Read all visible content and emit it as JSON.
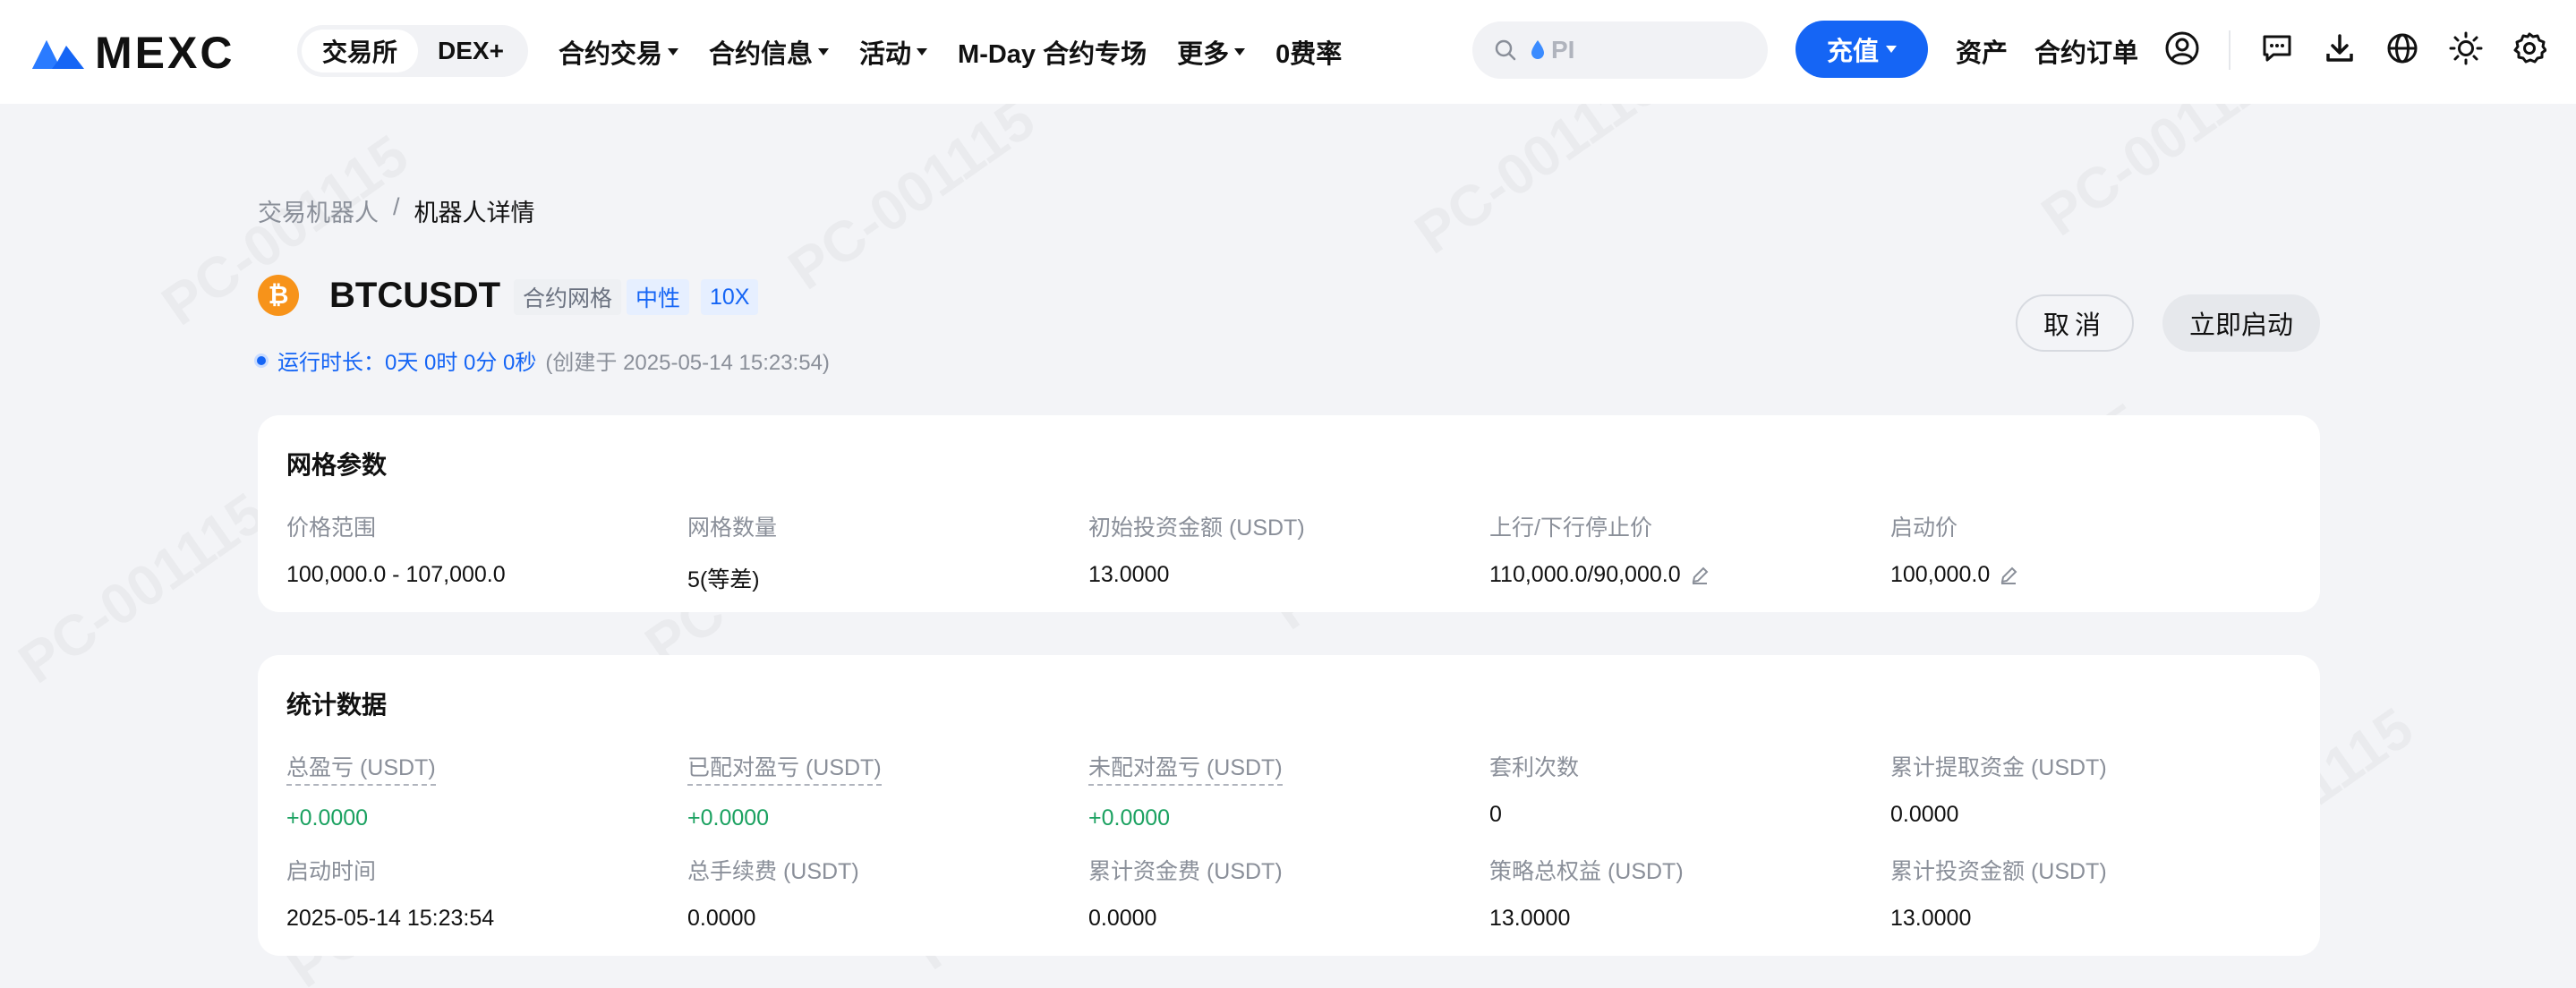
{
  "header": {
    "logo_text": "MEXC",
    "segment": {
      "active": "交易所",
      "other": "DEX+"
    },
    "nav": [
      {
        "label": "合约交易",
        "dropdown": true
      },
      {
        "label": "合约信息",
        "dropdown": true
      },
      {
        "label": "活动",
        "dropdown": true
      },
      {
        "label": "M-Day 合约专场",
        "dropdown": false
      },
      {
        "label": "更多",
        "dropdown": true
      },
      {
        "label": "0费率",
        "dropdown": false
      }
    ],
    "search_placeholder": "PI",
    "deposit_label": "充值",
    "assets_label": "资产",
    "orders_label": "合约订单",
    "icons": [
      "user-icon",
      "message-icon",
      "download-icon",
      "globe-icon",
      "theme-sun-icon",
      "settings-gear-icon"
    ]
  },
  "breadcrumb": {
    "parent": "交易机器人",
    "separator": "/",
    "current": "机器人详情"
  },
  "bot": {
    "coin_glyph": "₿",
    "symbol": "BTCUSDT",
    "tags": {
      "type": "合约网格",
      "direction": "中性",
      "leverage": "10X"
    },
    "runtime_label": "运行时长：0天 0时 0分 0秒",
    "created_label": "(创建于 2025-05-14 15:23:54)",
    "cancel_label": "取消",
    "start_label": "立即启动"
  },
  "grid_params": {
    "title": "网格参数",
    "items": [
      {
        "label": "价格范围",
        "value": "100,000.0 - 107,000.0"
      },
      {
        "label": "网格数量",
        "value": "5(等差)"
      },
      {
        "label": "初始投资金额 (USDT)",
        "value": "13.0000"
      },
      {
        "label": "上行/下行停止价",
        "value": "110,000.0/90,000.0"
      },
      {
        "label": "启动价",
        "value": "100,000.0"
      }
    ]
  },
  "stats": {
    "title": "统计数据",
    "row1": [
      {
        "label": "总盈亏 (USDT)",
        "value": "+0.0000"
      },
      {
        "label": "已配对盈亏 (USDT)",
        "value": "+0.0000"
      },
      {
        "label": "未配对盈亏 (USDT)",
        "value": "+0.0000"
      },
      {
        "label": "套利次数",
        "value": "0"
      },
      {
        "label": "累计提取资金 (USDT)",
        "value": "0.0000"
      }
    ],
    "row2": [
      {
        "label": "启动时间",
        "value": "2025-05-14 15:23:54"
      },
      {
        "label": "总手续费 (USDT)",
        "value": "0.0000"
      },
      {
        "label": "累计资金费 (USDT)",
        "value": "0.0000"
      },
      {
        "label": "策略总权益 (USDT)",
        "value": "13.0000"
      },
      {
        "label": "累计投资金额 (USDT)",
        "value": "13.0000"
      }
    ]
  },
  "colors": {
    "accent": "#1565f5",
    "profit": "#1aa160",
    "bitcoin": "#f7931a"
  },
  "watermark": "PC-001115"
}
